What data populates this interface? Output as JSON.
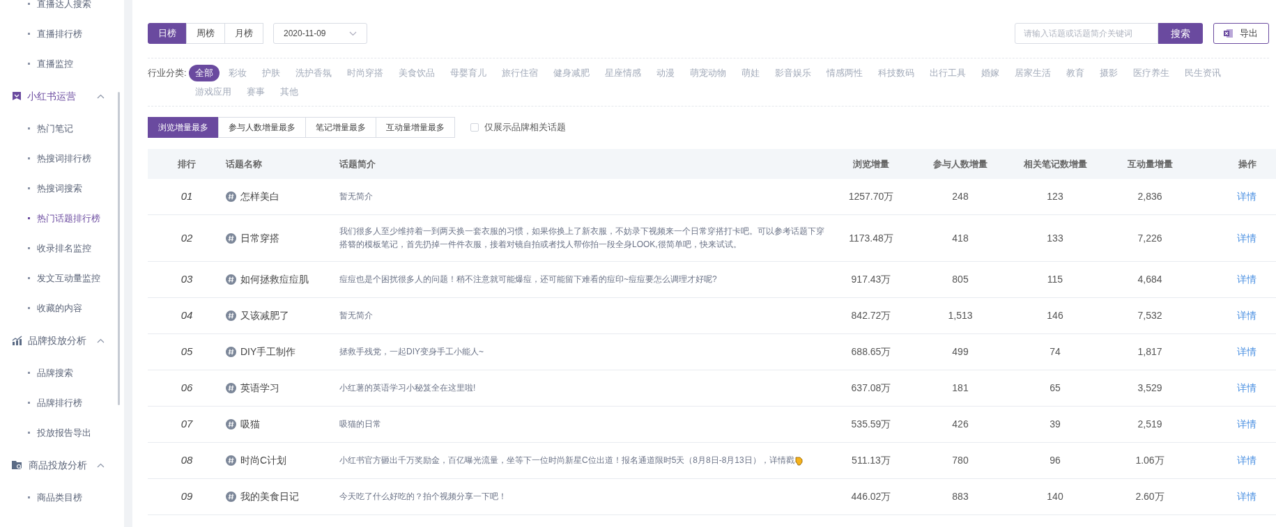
{
  "sidebar": {
    "sections": [
      {
        "items": [
          {
            "label": "直播达人搜索",
            "selected": false
          },
          {
            "label": "直播排行榜",
            "selected": false
          },
          {
            "label": "直播监控",
            "selected": false
          }
        ]
      },
      {
        "title": "小红书运营",
        "expanded": true,
        "items": [
          {
            "label": "热门笔记",
            "selected": false
          },
          {
            "label": "热搜词排行榜",
            "selected": false
          },
          {
            "label": "热搜词搜索",
            "selected": false
          },
          {
            "label": "热门话题排行榜",
            "selected": true
          },
          {
            "label": "收录排名监控",
            "selected": false
          },
          {
            "label": "发文互动量监控",
            "selected": false
          },
          {
            "label": "收藏的内容",
            "selected": false
          }
        ]
      },
      {
        "title": "品牌投放分析",
        "expanded": true,
        "items": [
          {
            "label": "品牌搜索",
            "selected": false
          },
          {
            "label": "品牌排行榜",
            "selected": false
          },
          {
            "label": "投放报告导出",
            "selected": false
          }
        ]
      },
      {
        "title": "商品投放分析",
        "expanded": true,
        "items": [
          {
            "label": "商品类目榜",
            "selected": false
          }
        ]
      }
    ]
  },
  "period_tabs": [
    {
      "label": "日榜",
      "selected": true
    },
    {
      "label": "周榜",
      "selected": false
    },
    {
      "label": "月榜",
      "selected": false
    }
  ],
  "date_select": {
    "value": "2020-11-09"
  },
  "search": {
    "placeholder": "请输入话题或话题简介关键词",
    "button": "搜索"
  },
  "export_button": "导出",
  "categories": {
    "label": "行业分类:",
    "items": [
      {
        "label": "全部",
        "selected": true
      },
      {
        "label": "彩妆",
        "selected": false
      },
      {
        "label": "护肤",
        "selected": false
      },
      {
        "label": "洗护香氛",
        "selected": false
      },
      {
        "label": "时尚穿搭",
        "selected": false
      },
      {
        "label": "美食饮品",
        "selected": false
      },
      {
        "label": "母婴育儿",
        "selected": false
      },
      {
        "label": "旅行住宿",
        "selected": false
      },
      {
        "label": "健身减肥",
        "selected": false
      },
      {
        "label": "星座情感",
        "selected": false
      },
      {
        "label": "动漫",
        "selected": false
      },
      {
        "label": "萌宠动物",
        "selected": false
      },
      {
        "label": "萌娃",
        "selected": false
      },
      {
        "label": "影音娱乐",
        "selected": false
      },
      {
        "label": "情感两性",
        "selected": false
      },
      {
        "label": "科技数码",
        "selected": false
      },
      {
        "label": "出行工具",
        "selected": false
      },
      {
        "label": "婚嫁",
        "selected": false
      },
      {
        "label": "居家生活",
        "selected": false
      },
      {
        "label": "教育",
        "selected": false
      },
      {
        "label": "摄影",
        "selected": false
      },
      {
        "label": "医疗养生",
        "selected": false
      },
      {
        "label": "民生资讯",
        "selected": false
      },
      {
        "label": "游戏应用",
        "selected": false
      },
      {
        "label": "赛事",
        "selected": false
      },
      {
        "label": "其他",
        "selected": false
      }
    ]
  },
  "sort_tabs": [
    {
      "label": "浏览增量最多",
      "selected": true
    },
    {
      "label": "参与人数增量最多",
      "selected": false
    },
    {
      "label": "笔记增量最多",
      "selected": false
    },
    {
      "label": "互动量增量最多",
      "selected": false
    }
  ],
  "brand_filter": {
    "label": "仅展示品牌相关话题",
    "checked": false
  },
  "table": {
    "columns": [
      "排行",
      "话题名称",
      "话题简介",
      "浏览增量",
      "参与人数增量",
      "相关笔记数增量",
      "互动量增量",
      "操作"
    ],
    "rows": [
      {
        "rank": "01",
        "name": "怎样美白",
        "intro": "暂无简介",
        "views": "1257.70万",
        "participants": "248",
        "notes": "123",
        "interactions": "2,836",
        "action": "详情",
        "emoji": false
      },
      {
        "rank": "02",
        "name": "日常穿搭",
        "intro": "我们很多人至少维持着一到两天换一套衣服的习惯，如果你换上了新衣服，不妨录下视频来一个日常穿搭打卡吧。可以参考话题下穿搭簪的模板笔记，首先扔掉一件件衣服，接着对镜自拍或者找人帮你拍一段全身LOOK,很简单吧，快来试试。",
        "views": "1173.48万",
        "participants": "418",
        "notes": "133",
        "interactions": "7,226",
        "action": "详情",
        "emoji": false
      },
      {
        "rank": "03",
        "name": "如何拯救痘痘肌",
        "intro": "痘痘也是个困扰很多人的问题！稍不注意就可能爆痘，还可能留下难看的痘印~痘痘要怎么调理才好呢?",
        "views": "917.43万",
        "participants": "805",
        "notes": "115",
        "interactions": "4,684",
        "action": "详情",
        "emoji": false
      },
      {
        "rank": "04",
        "name": "又该减肥了",
        "intro": "暂无简介",
        "views": "842.72万",
        "participants": "1,513",
        "notes": "146",
        "interactions": "7,532",
        "action": "详情",
        "emoji": false
      },
      {
        "rank": "05",
        "name": "DIY手工制作",
        "intro": "拯救手残党，一起DIY变身手工小能人~",
        "views": "688.65万",
        "participants": "499",
        "notes": "74",
        "interactions": "1,817",
        "action": "详情",
        "emoji": false
      },
      {
        "rank": "06",
        "name": "英语学习",
        "intro": "小红薯的英语学习小秘笈全在这里啦!",
        "views": "637.08万",
        "participants": "181",
        "notes": "65",
        "interactions": "3,529",
        "action": "详情",
        "emoji": false
      },
      {
        "rank": "07",
        "name": "吸猫",
        "intro": "吸猫的日常",
        "views": "535.59万",
        "participants": "426",
        "notes": "39",
        "interactions": "2,519",
        "action": "详情",
        "emoji": false
      },
      {
        "rank": "08",
        "name": "时尚C计划",
        "intro": "小红书官方砸出千万奖励金，百亿曝光流量，坐等下一位时尚新星C位出道！报名通道限时5天（8月8日-8月13日），详情戳",
        "views": "511.13万",
        "participants": "780",
        "notes": "96",
        "interactions": "1.06万",
        "action": "详情",
        "emoji": true
      },
      {
        "rank": "09",
        "name": "我的美食日记",
        "intro": "今天吃了什么好吃的？拍个视频分享一下吧！",
        "views": "446.02万",
        "participants": "883",
        "notes": "140",
        "interactions": "2.60万",
        "action": "详情",
        "emoji": false
      }
    ]
  }
}
